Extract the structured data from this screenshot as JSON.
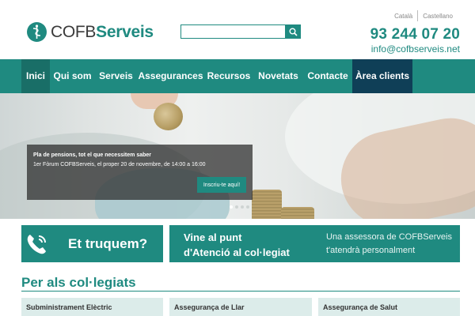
{
  "brand": {
    "name_part1": "COFB",
    "name_part2": "Serveis",
    "accent": "#1f8a80",
    "dark_accent": "#0f3f57"
  },
  "header": {
    "search": {
      "placeholder": "",
      "value": "",
      "button_icon": "search-icon"
    },
    "languages": [
      "Català",
      "Castellano"
    ],
    "phone": "93 244 07 20",
    "email": "info@cofbserveis.net"
  },
  "nav": {
    "items": [
      {
        "label": "Inici",
        "active": true
      },
      {
        "label": "Qui som"
      },
      {
        "label": "Serveis"
      },
      {
        "label": "Assegurances"
      },
      {
        "label": "Recursos"
      },
      {
        "label": "Novetats"
      },
      {
        "label": "Contacte"
      },
      {
        "label": "Àrea clients",
        "highlight": true
      }
    ]
  },
  "hero": {
    "title": "Pla de pensions, tot el que necessitem saber",
    "subtitle": "1er Fòrum COFBServeis, el proper 20 de novembre, de 14:00 a 16:00",
    "button": "Inscriu-te aquí!",
    "slides": 4,
    "active_slide": 1
  },
  "banners": {
    "call": {
      "icon": "phone-icon",
      "label": "Et truquem?"
    },
    "visit": {
      "title_line1": "Vine al punt",
      "title_line2": "d'Atenció al col·legiat",
      "desc_line1": "Una assessora de COFBServeis",
      "desc_line2": "t'atendrà personalment"
    }
  },
  "section": {
    "title": "Per als col·legiats",
    "cards": [
      "Subministrament Elèctric",
      "Assegurança de Llar",
      "Assegurança de Salut"
    ]
  }
}
